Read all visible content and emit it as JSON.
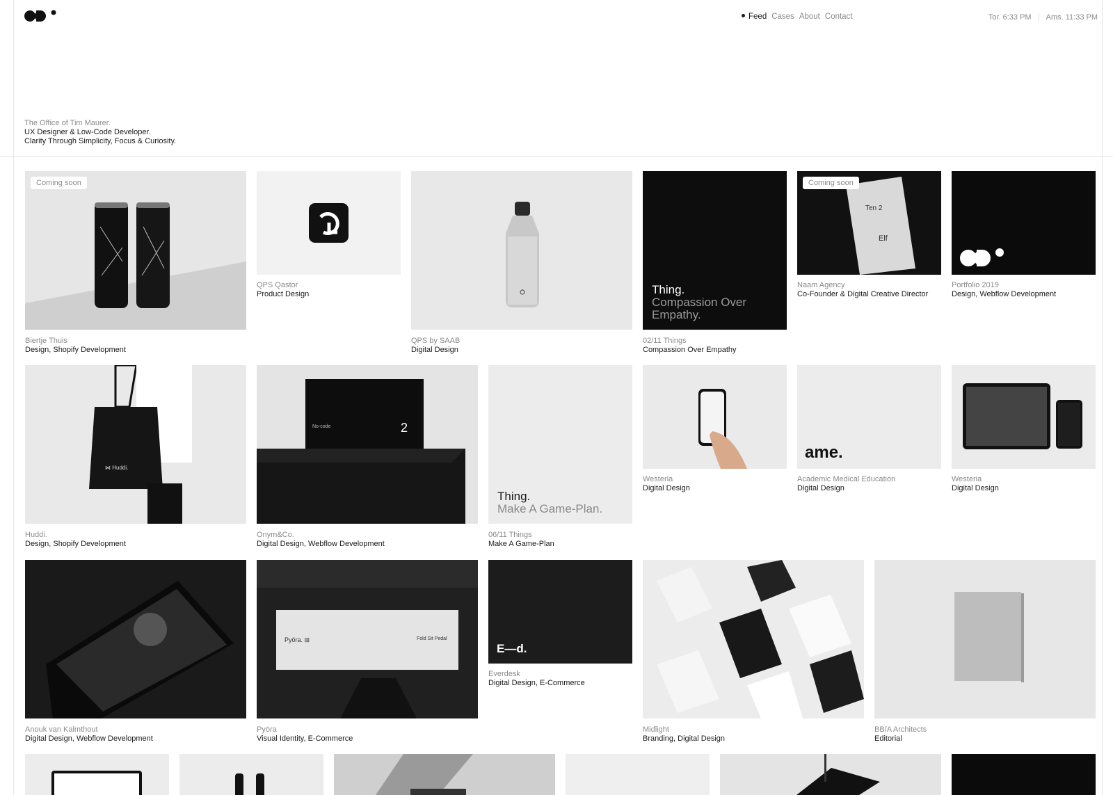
{
  "nav": {
    "items": [
      "Feed",
      "Cases",
      "About",
      "Contact"
    ],
    "active": "Feed"
  },
  "clocks": {
    "tor": "Tor. 6:33 PM",
    "ams": "Ams. 11:33 PM"
  },
  "intro": {
    "line1": "The Office of Tim Maurer.",
    "line2": "UX Designer & Low-Code Developer.",
    "line3": "Clarity Through Simplicity, Focus & Curiosity."
  },
  "badges": {
    "coming_soon": "Coming soon"
  },
  "cards": {
    "biertje": {
      "title": "Biertje Thuis",
      "sub": "Design, Shopify Development"
    },
    "qastor": {
      "title": "QPS Qastor",
      "sub": "Product Design"
    },
    "saab": {
      "title": "QPS by SAAB",
      "sub": "Digital Design"
    },
    "things02": {
      "title": "02/11 Things",
      "sub": "Compassion Over Empathy",
      "big1": "Thing.",
      "big2": "Compassion Over",
      "big3": "Empathy."
    },
    "naam": {
      "title": "Naam Agency",
      "sub": "Co-Founder & Digital Creative Director"
    },
    "portfolio": {
      "title": "Portfolio 2019",
      "sub": "Design, Webflow Development"
    },
    "huddi": {
      "title": "Huddi.",
      "sub": "Design, Shopify Development"
    },
    "onym": {
      "title": "Onym&Co.",
      "sub": "Digital Design, Webflow Development"
    },
    "things06": {
      "title": "06/11 Things",
      "sub": "Make A Game-Plan",
      "big1": "Thing.",
      "big2": "Make A Game-Plan."
    },
    "westeria1": {
      "title": "Westeria",
      "sub": "Digital Design"
    },
    "ame": {
      "title": "Academic Medical Education",
      "sub": "Digital Design",
      "mark": "ame."
    },
    "westeria2": {
      "title": "Westeria",
      "sub": "Digital Design"
    },
    "anouk": {
      "title": "Anouk van Kalmthout",
      "sub": "Digital Design, Webflow Development"
    },
    "pyora": {
      "title": "Pyöra",
      "sub": "Visual Identity, E-Commerce",
      "sign_left": "Pyöra. ⊞",
      "sign_right": "Fold Sit Pedal"
    },
    "everdesk": {
      "title": "Everdesk",
      "sub": "Digital Design, E-Commerce",
      "mark": "E—d."
    },
    "midlight": {
      "title": "Midlight",
      "sub": "Branding, Digital Design"
    },
    "bba": {
      "title": "BB/A Architects",
      "sub": "Editorial"
    }
  },
  "colors": {
    "text": "#1a1a1a",
    "muted": "#8a8a8a",
    "tile_light": "#ededed",
    "tile_dark": "#0d0d0d"
  }
}
